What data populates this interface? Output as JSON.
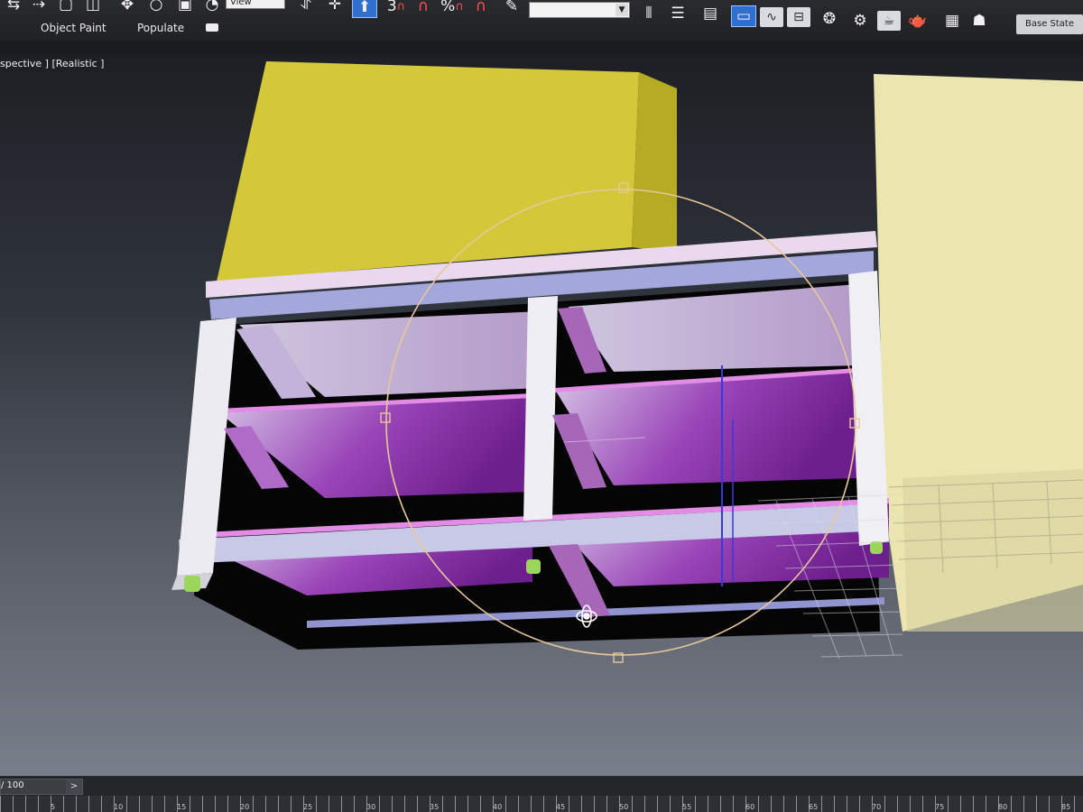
{
  "toolbar": {
    "ref_coord_value": "View",
    "snaps_label": "3",
    "percent_snap_label": "%",
    "named_selection_value": "",
    "base_state_label": "Base State",
    "icons": [
      "select-link-icon",
      "select-object-icon",
      "select-region-icon",
      "window-crossing-icon",
      "select-move-icon",
      "select-rotate-icon",
      "select-scale-icon",
      "reference-coord-icon",
      "use-pivot-icon",
      "move-gizmo-icon",
      "keyboard-shortcut-icon",
      "snaps-toggle-icon",
      "angle-snap-icon",
      "percent-snap-icon",
      "spinner-snap-icon",
      "edit-named-selection-icon",
      "mirror-icon",
      "align-icon",
      "toggle-layer-explorer-icon",
      "toggle-ribbon-icon",
      "curve-editor-icon",
      "schematic-view-icon",
      "material-editor-icon",
      "render-setup-icon",
      "rendered-frame-icon",
      "render-production-icon",
      "render-teapot-icon",
      "scene-states-icon"
    ]
  },
  "ribbon": {
    "tabs": [
      "Object Paint",
      "Populate"
    ]
  },
  "viewport": {
    "label": "spective ] [Realistic ]",
    "colors": {
      "yellow_box": "#d4c83a",
      "cream_box": "#ebe6b0",
      "shelf_frame": "#e9e6f0",
      "shelf_panel": "#7a2a9a",
      "selection_circle": "#e8c79a"
    }
  },
  "timeline": {
    "frame_readout": "/ 100",
    "next_label": ">",
    "ruler_ticks": [
      "5",
      "10",
      "15",
      "20",
      "25",
      "30",
      "35",
      "40",
      "45",
      "50",
      "55",
      "60",
      "65",
      "70",
      "75",
      "80",
      "85"
    ]
  }
}
